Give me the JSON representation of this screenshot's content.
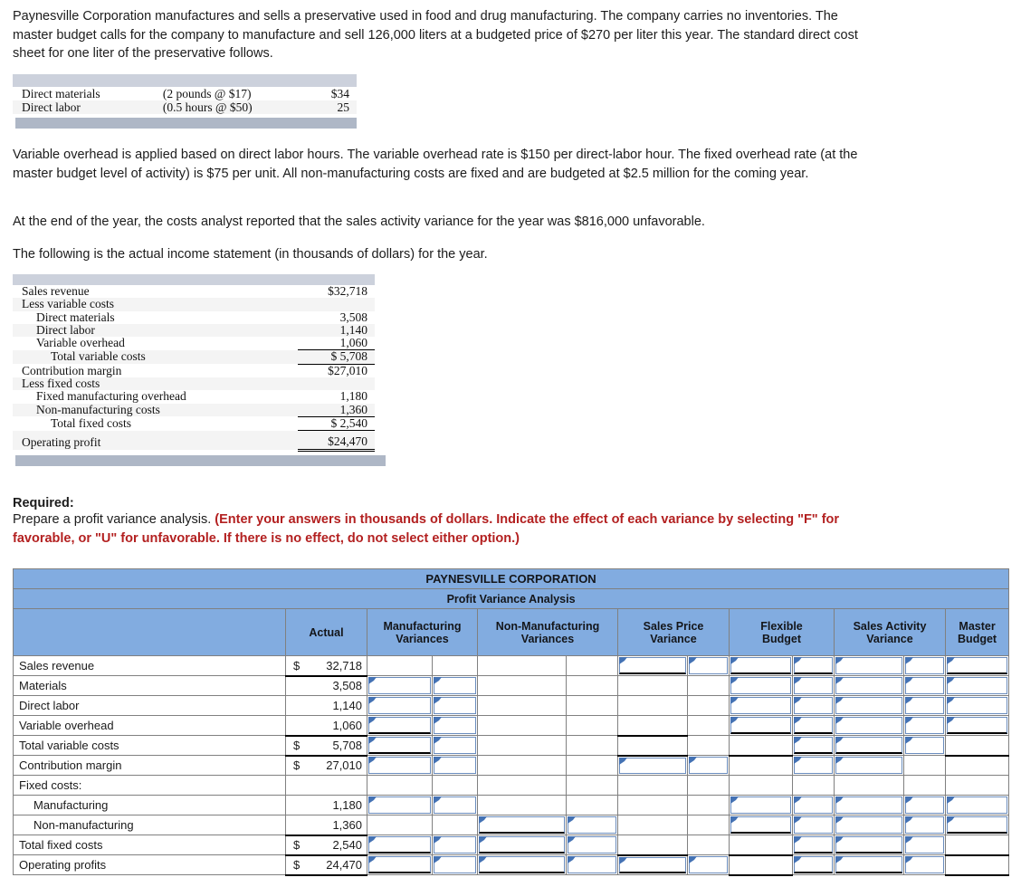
{
  "intro": {
    "paragraph1": "Paynesville Corporation manufactures and sells a preservative used in food and drug manufacturing. The company carries no inventories. The master budget calls for the company to manufacture and sell 126,000 liters at a budgeted price of $270 per liter this year. The standard direct cost sheet for one liter of the preservative follows.",
    "paragraph2": "Variable overhead is applied based on direct labor hours. The variable overhead rate is $150 per direct-labor hour. The fixed overhead rate (at the master budget level of activity) is $75 per unit. All non-manufacturing costs are fixed and are budgeted at $2.5 million for the coming year.",
    "paragraph3": "At the end of the year, the costs analyst reported that the sales activity variance for the year was $816,000 unfavorable.",
    "paragraph4": "The following is the actual income statement (in thousands of dollars) for the year."
  },
  "cost_sheet": {
    "rows": [
      {
        "label": "Direct materials",
        "detail": "(2 pounds @ $17)",
        "amount": "$34"
      },
      {
        "label": "Direct labor",
        "detail": "(0.5 hours @ $50)",
        "amount": "25"
      }
    ]
  },
  "income_statement": {
    "rows": [
      {
        "label": "Sales revenue",
        "indent": 0,
        "amount": "$32,718",
        "rule": "none"
      },
      {
        "label": "Less variable costs",
        "indent": 0,
        "amount": "",
        "rule": "none"
      },
      {
        "label": "Direct materials",
        "indent": 1,
        "amount": "3,508",
        "rule": "none"
      },
      {
        "label": "Direct labor",
        "indent": 1,
        "amount": "1,140",
        "rule": "none"
      },
      {
        "label": "Variable overhead",
        "indent": 1,
        "amount": "1,060",
        "rule": "none"
      },
      {
        "label": "Total variable costs",
        "indent": 2,
        "amount": "$  5,708",
        "rule": "top"
      },
      {
        "label": "Contribution margin",
        "indent": 0,
        "amount": "$27,010",
        "rule": "top"
      },
      {
        "label": "Less fixed costs",
        "indent": 0,
        "amount": "",
        "rule": "none"
      },
      {
        "label": "Fixed manufacturing overhead",
        "indent": 1,
        "amount": "1,180",
        "rule": "none"
      },
      {
        "label": "Non-manufacturing costs",
        "indent": 1,
        "amount": "1,360",
        "rule": "none"
      },
      {
        "label": "Total fixed costs",
        "indent": 2,
        "amount": "$  2,540",
        "rule": "top"
      },
      {
        "label": "Operating profit",
        "indent": 0,
        "amount": "$24,470",
        "rule": "topdouble"
      }
    ]
  },
  "required": {
    "title": "Required:",
    "lead": "Prepare a profit variance analysis.",
    "instruction": "(Enter your answers in thousands of dollars. Indicate the effect of each variance by selecting \"F\" for favorable, or \"U\" for unfavorable. If there is no effect, do not select either option.)"
  },
  "worksheet": {
    "company": "PAYNESVILLE CORPORATION",
    "subtitle": "Profit Variance Analysis",
    "columns": [
      {
        "label": "",
        "key": "rowlabel"
      },
      {
        "label": "Actual",
        "key": "actual"
      },
      {
        "label": "Manufacturing\nVariances",
        "key": "mfg"
      },
      {
        "label": "Non-Manufacturing\nVariances",
        "key": "nonmfg"
      },
      {
        "label": "Sales Price\nVariance",
        "key": "salesprice"
      },
      {
        "label": "Flexible\nBudget",
        "key": "flexbudget"
      },
      {
        "label": "Sales Activity\nVariance",
        "key": "salesactivity"
      },
      {
        "label": "Master\nBudget",
        "key": "masterbudget"
      }
    ],
    "column_labels": {
      "actual": "Actual",
      "mfg_line1": "Manufacturing",
      "mfg_line2": "Variances",
      "nonmfg_line1": "Non-Manufacturing",
      "nonmfg_line2": "Variances",
      "salesprice_line1": "Sales Price",
      "salesprice_line2": "Variance",
      "flexbudget_line1": "Flexible",
      "flexbudget_line2": "Budget",
      "salesactivity_line1": "Sales Activity",
      "salesactivity_line2": "Variance",
      "masterbudget_line1": "Master",
      "masterbudget_line2": "Budget"
    },
    "rows": [
      {
        "label": "Sales revenue",
        "indent": 0,
        "dollar": "$",
        "actual": "32,718",
        "actual_rule": "bottom"
      },
      {
        "label": "Materials",
        "indent": 0,
        "dollar": "",
        "actual": "3,508",
        "actual_rule": "none"
      },
      {
        "label": "Direct labor",
        "indent": 0,
        "dollar": "",
        "actual": "1,140",
        "actual_rule": "none"
      },
      {
        "label": "Variable overhead",
        "indent": 0,
        "dollar": "",
        "actual": "1,060",
        "actual_rule": "bottom"
      },
      {
        "label": "Total variable costs",
        "indent": 0,
        "dollar": "$",
        "actual": "5,708",
        "actual_rule": "bottom"
      },
      {
        "label": "Contribution margin",
        "indent": 0,
        "dollar": "$",
        "actual": "27,010",
        "actual_rule": "none"
      },
      {
        "label": "Fixed costs:",
        "indent": 0,
        "dollar": "",
        "actual": "",
        "actual_rule": "none"
      },
      {
        "label": "Manufacturing",
        "indent": 1,
        "dollar": "",
        "actual": "1,180",
        "actual_rule": "none"
      },
      {
        "label": "Non-manufacturing",
        "indent": 1,
        "dollar": "",
        "actual": "1,360",
        "actual_rule": "bottom"
      },
      {
        "label": "Total fixed costs",
        "indent": 0,
        "dollar": "$",
        "actual": "2,540",
        "actual_rule": "bottom"
      },
      {
        "label": "Operating profits",
        "indent": 0,
        "dollar": "$",
        "actual": "24,470",
        "actual_rule": "bottom"
      }
    ],
    "colors": {
      "header_blue": "#82ace0",
      "grid_gray": "#808080",
      "input_border_blue": "#6a8cbd",
      "marker_blue": "#4472b4",
      "instruction_red": "#b32020"
    }
  }
}
